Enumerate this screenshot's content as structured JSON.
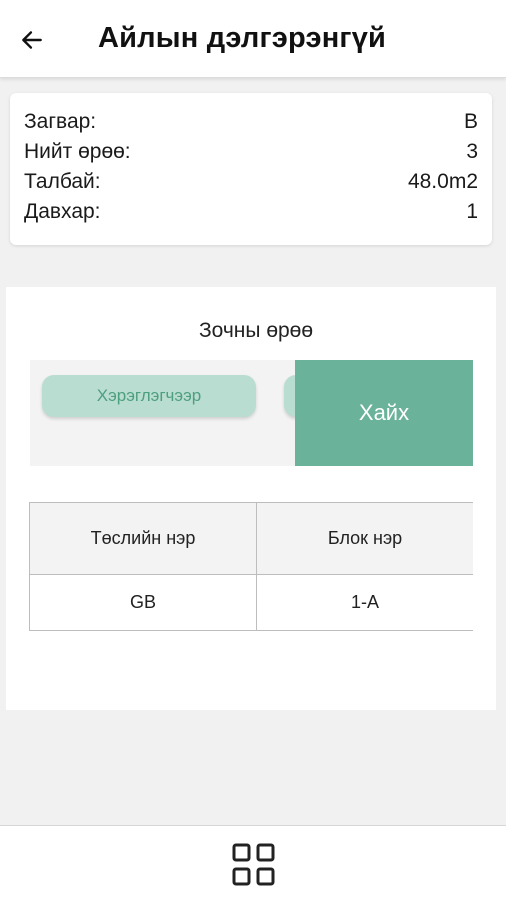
{
  "header": {
    "title": "Айлын дэлгэрэнгүй",
    "back_icon": "arrow-left-icon"
  },
  "info": {
    "rows": [
      {
        "label": "Загвар:",
        "value": "B"
      },
      {
        "label": "Нийт өрөө:",
        "value": "3"
      },
      {
        "label": "Талбай:",
        "value": "48.0m2"
      },
      {
        "label": "Давхар:",
        "value": "1"
      }
    ]
  },
  "occupants": {
    "title": "Зочны өрөө",
    "filter_chip_label": "Хэрэглэгчээр",
    "search_label": "Хайх",
    "table": {
      "headers": [
        "Төслийн нэр",
        "Блок нэр"
      ],
      "rows": [
        [
          "GB",
          "1-A"
        ]
      ]
    }
  },
  "bottom_nav": {
    "icon": "grid-icon"
  },
  "colors": {
    "accent": "#6ab39a",
    "chip_bg": "#b9ddd0",
    "chip_text": "#4e9e80",
    "background": "#f1f1f1"
  }
}
